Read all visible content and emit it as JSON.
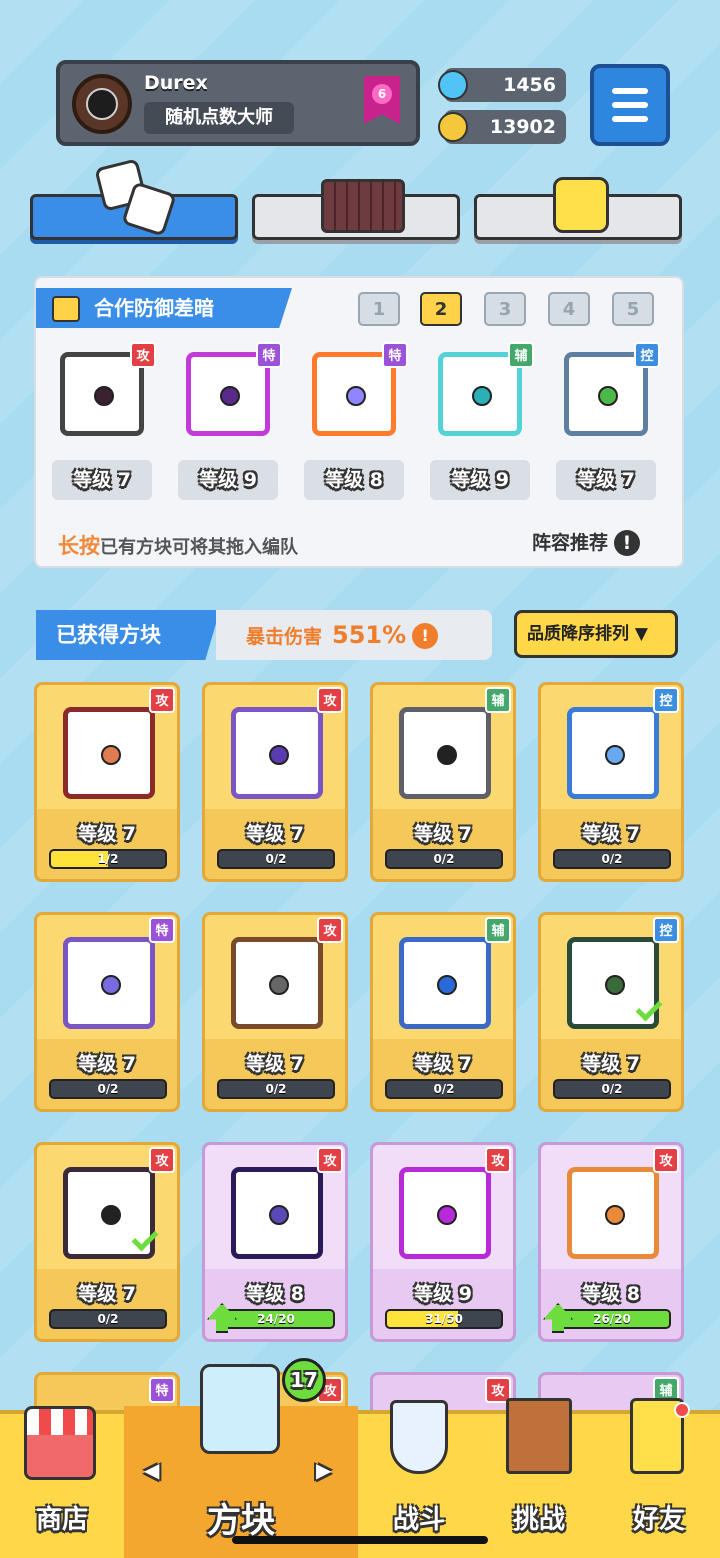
{
  "colors": {
    "atk": "#e34046",
    "spc": "#9b52d8",
    "sup": "#43a86a",
    "ctl": "#3c8ee0"
  },
  "player": {
    "name": "Durex",
    "title": "随机点数大师",
    "rank": "6",
    "avatar": "apple-logo"
  },
  "currency": {
    "gems": "1456",
    "coins": "13902"
  },
  "lineup": {
    "title": "合作防御差暗",
    "tabs": [
      "1",
      "2",
      "3",
      "4",
      "5"
    ],
    "active_tab": "2",
    "cards": [
      {
        "tag": "攻",
        "type": "atk",
        "level": "等级 7",
        "ring": "#444",
        "dot": "#3a2030"
      },
      {
        "tag": "特",
        "type": "spc",
        "level": "等级 9",
        "ring": "#c23bd6",
        "dot": "#5a2a8a"
      },
      {
        "tag": "特",
        "type": "spc",
        "level": "等级 8",
        "ring": "#ff7a2a",
        "dot": "#8f86ff"
      },
      {
        "tag": "辅",
        "type": "sup",
        "level": "等级 9",
        "ring": "#53d3d6",
        "dot": "#2bb0b5"
      },
      {
        "tag": "控",
        "type": "ctl",
        "level": "等级 7",
        "ring": "#5e7ea2",
        "dot": "#4cb84c"
      }
    ],
    "hint_key": "长按",
    "hint_text": "已有方块可将其拖入编队",
    "recommend": "阵容推荐",
    "recommend_icon": "!"
  },
  "obtained": {
    "title": "已获得方块",
    "crit_label": "暴击伤害",
    "crit_value": "551%",
    "crit_icon": "!",
    "sort": "品质降序排列 ▼"
  },
  "grid": [
    {
      "tag": "攻",
      "type": "atk",
      "level": "等级 7",
      "progress": "1/2",
      "fill": 0.5,
      "fillColor": "#ffe23a",
      "style": "gold",
      "ring": "#8a2a2a",
      "dot": "#e07d50"
    },
    {
      "tag": "攻",
      "type": "atk",
      "level": "等级 7",
      "progress": "0/2",
      "fill": 0,
      "fillColor": "#ffe23a",
      "style": "gold",
      "ring": "#7a56c4",
      "dot": "#5a3cb0"
    },
    {
      "tag": "辅",
      "type": "sup",
      "level": "等级 7",
      "progress": "0/2",
      "fill": 0,
      "fillColor": "#ffe23a",
      "style": "gold",
      "ring": "#60606a",
      "dot": "#222"
    },
    {
      "tag": "控",
      "type": "ctl",
      "level": "等级 7",
      "progress": "0/2",
      "fill": 0,
      "fillColor": "#ffe23a",
      "style": "gold",
      "ring": "#3a7ad8",
      "dot": "#6aa8ef"
    },
    {
      "tag": "特",
      "type": "spc",
      "level": "等级 7",
      "progress": "0/2",
      "fill": 0,
      "fillColor": "#ffe23a",
      "style": "gold",
      "ring": "#7a56c4",
      "dot": "#7a6ae0"
    },
    {
      "tag": "攻",
      "type": "atk",
      "level": "等级 7",
      "progress": "0/2",
      "fill": 0,
      "fillColor": "#ffe23a",
      "style": "gold",
      "ring": "#7a4a2a",
      "dot": "#666"
    },
    {
      "tag": "辅",
      "type": "sup",
      "level": "等级 7",
      "progress": "0/2",
      "fill": 0,
      "fillColor": "#ffe23a",
      "style": "gold",
      "ring": "#3a6ac8",
      "dot": "#2a6ad8"
    },
    {
      "tag": "控",
      "type": "ctl",
      "level": "等级 7",
      "progress": "0/2",
      "fill": 0,
      "fillColor": "#ffe23a",
      "style": "gold",
      "ring": "#2a4a3a",
      "dot": "#3a6a3a",
      "check": true
    },
    {
      "tag": "攻",
      "type": "atk",
      "level": "等级 7",
      "progress": "0/2",
      "fill": 0,
      "fillColor": "#ffe23a",
      "style": "gold",
      "ring": "#3a2a3a",
      "dot": "#222",
      "check": true
    },
    {
      "tag": "攻",
      "type": "atk",
      "level": "等级 8",
      "progress": "24/20",
      "fill": 1,
      "fillColor": "#6ddc3d",
      "style": "purple",
      "ring": "#2a1a5a",
      "dot": "#5a4ab8",
      "up": true
    },
    {
      "tag": "攻",
      "type": "atk",
      "level": "等级 9",
      "progress": "31/50",
      "fill": 0.62,
      "fillColor": "#ffe23a",
      "style": "purple",
      "ring": "#b62ad8",
      "dot": "#b62ad8"
    },
    {
      "tag": "攻",
      "type": "atk",
      "level": "等级 8",
      "progress": "26/20",
      "fill": 1,
      "fillColor": "#6ddc3d",
      "style": "purple",
      "ring": "#e88a3a",
      "dot": "#e88a3a",
      "up": true
    }
  ],
  "partial_row": [
    {
      "tag": "特",
      "type": "spc"
    },
    {
      "tag": "攻",
      "type": "atk"
    },
    {
      "tag": "攻",
      "type": "atk"
    },
    {
      "tag": "辅",
      "type": "sup"
    }
  ],
  "nav": {
    "shop": "商店",
    "blocks": "方块",
    "battle": "战斗",
    "challenge": "挑战",
    "friends": "好友",
    "badge": "17",
    "prev": "◀",
    "next": "▶"
  }
}
